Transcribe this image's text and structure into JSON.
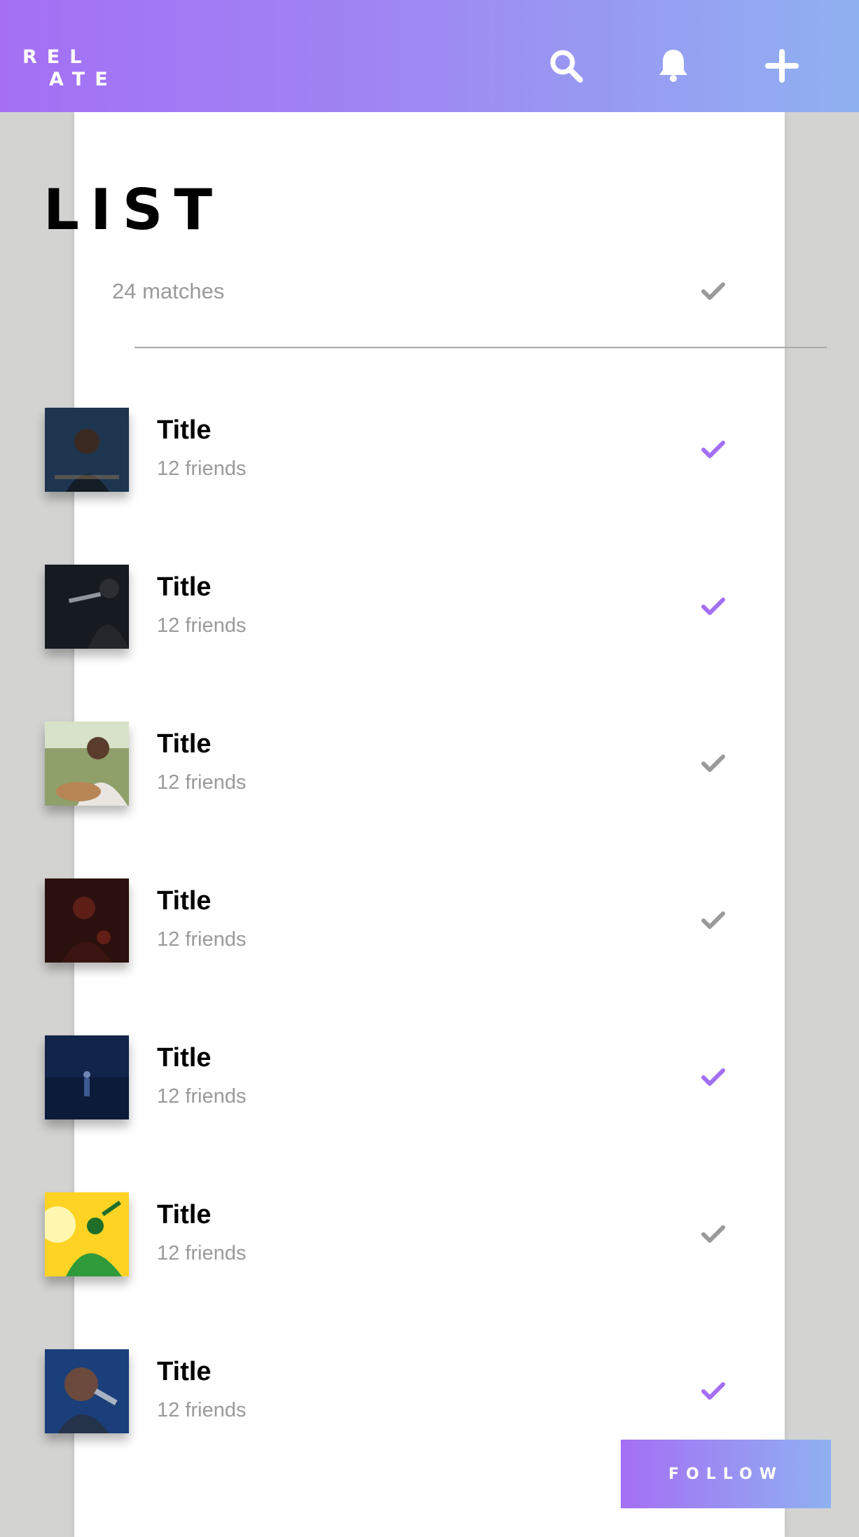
{
  "header": {
    "logo_line1": "REL",
    "logo_line2": "ATE",
    "icons": [
      "search-icon",
      "bell-icon",
      "plus-icon"
    ],
    "gradient": [
      "#a46ff4",
      "#8fb1f1"
    ]
  },
  "page": {
    "title": "LIST",
    "match_count": "24 matches",
    "accent_color": "#a46ff4",
    "muted_color": "#9a9a9a"
  },
  "items": [
    {
      "title": "Title",
      "subtitle": "12 friends",
      "selected": true
    },
    {
      "title": "Title",
      "subtitle": "12 friends",
      "selected": true
    },
    {
      "title": "Title",
      "subtitle": "12 friends",
      "selected": false
    },
    {
      "title": "Title",
      "subtitle": "12 friends",
      "selected": false
    },
    {
      "title": "Title",
      "subtitle": "12 friends",
      "selected": true
    },
    {
      "title": "Title",
      "subtitle": "12 friends",
      "selected": false
    },
    {
      "title": "Title",
      "subtitle": "12 friends",
      "selected": true
    }
  ],
  "follow_label": "FOLLOW"
}
